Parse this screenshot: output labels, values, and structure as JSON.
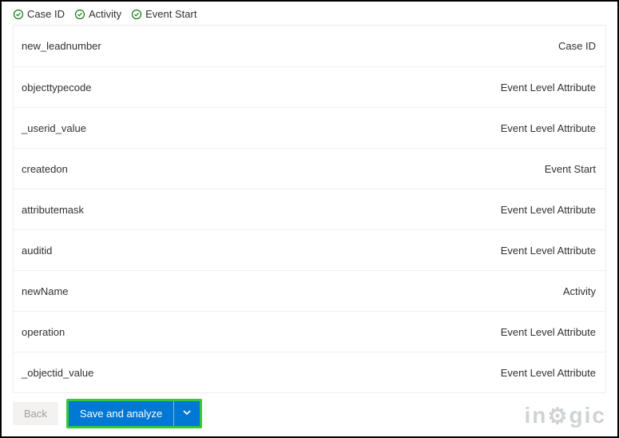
{
  "header": {
    "pills": [
      {
        "label": "Case ID"
      },
      {
        "label": "Activity"
      },
      {
        "label": "Event Start"
      }
    ]
  },
  "rows": [
    {
      "field": "new_leadnumber",
      "type": "Case ID"
    },
    {
      "field": "objecttypecode",
      "type": "Event Level Attribute"
    },
    {
      "field": "_userid_value",
      "type": "Event Level Attribute"
    },
    {
      "field": "createdon",
      "type": "Event Start"
    },
    {
      "field": "attributemask",
      "type": "Event Level Attribute"
    },
    {
      "field": "auditid",
      "type": "Event Level Attribute"
    },
    {
      "field": "newName",
      "type": "Activity"
    },
    {
      "field": "operation",
      "type": "Event Level Attribute"
    },
    {
      "field": "_objectid_value",
      "type": "Event Level Attribute"
    }
  ],
  "footer": {
    "back": "Back",
    "primary": "Save and analyze",
    "logo": "inogic"
  }
}
